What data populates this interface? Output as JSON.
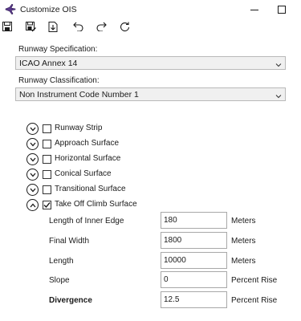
{
  "window": {
    "title": "Customize OIS",
    "icon": "app-plane-icon",
    "minimize_icon": "minimize-icon",
    "maximize_icon": "maximize-icon"
  },
  "toolbar": {
    "items": [
      {
        "icon": "save-icon"
      },
      {
        "icon": "save-as-icon"
      },
      {
        "icon": "export-icon"
      },
      {
        "icon": "undo-icon"
      },
      {
        "icon": "redo-icon"
      },
      {
        "icon": "refresh-icon"
      }
    ]
  },
  "runway_specification": {
    "label": "Runway Specification:",
    "selected": "ICAO Annex 14"
  },
  "runway_classification": {
    "label": "Runway Classification:",
    "selected": "Non Instrument Code Number 1"
  },
  "surfaces": [
    {
      "label": "Runway Strip",
      "checked": false,
      "expanded": false
    },
    {
      "label": "Approach Surface",
      "checked": false,
      "expanded": false
    },
    {
      "label": "Horizontal Surface",
      "checked": false,
      "expanded": false
    },
    {
      "label": "Conical Surface",
      "checked": false,
      "expanded": false
    },
    {
      "label": "Transitional Surface",
      "checked": false,
      "expanded": false
    },
    {
      "label": "Take Off Climb Surface",
      "checked": true,
      "expanded": true
    }
  ],
  "take_off_climb_params": [
    {
      "label": "Length of Inner Edge",
      "value": "180",
      "unit": "Meters",
      "bold": false
    },
    {
      "label": "Final Width",
      "value": "1800",
      "unit": "Meters",
      "bold": false
    },
    {
      "label": "Length",
      "value": "10000",
      "unit": "Meters",
      "bold": false
    },
    {
      "label": "Slope",
      "value": "0",
      "unit": "Percent Rise",
      "bold": false
    },
    {
      "label": "Divergence",
      "value": "12.5",
      "unit": "Percent Rise",
      "bold": true
    }
  ]
}
